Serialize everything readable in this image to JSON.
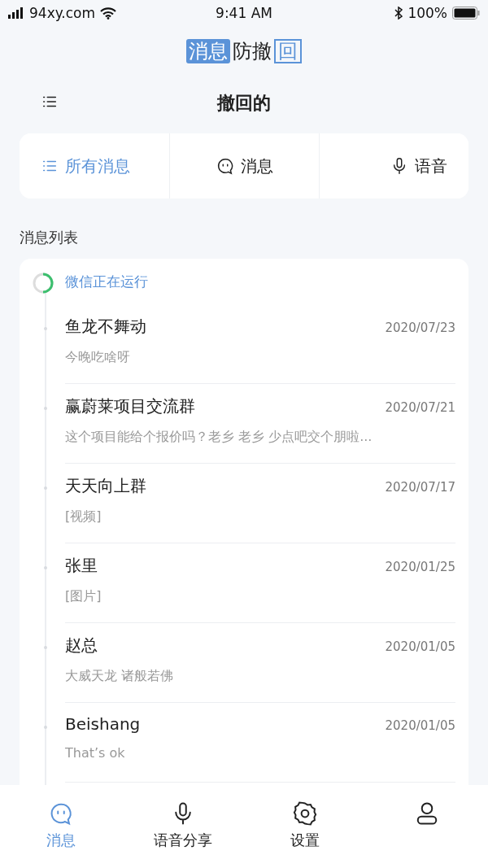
{
  "status_bar": {
    "carrier": "94xy.com",
    "time": "9:41 AM",
    "battery": "100%"
  },
  "logo": [
    {
      "text": "消息",
      "kind": "filled"
    },
    {
      "text": "防撤",
      "kind": "plain"
    },
    {
      "text": "回",
      "kind": "outlined"
    }
  ],
  "header": {
    "title": "撤回的"
  },
  "filters": [
    {
      "label": "所有消息",
      "kind": "list",
      "selected": true
    },
    {
      "label": "消息",
      "kind": "chat",
      "selected": false
    },
    {
      "label": "语音",
      "kind": "mic",
      "selected": false
    }
  ],
  "section_title": "消息列表",
  "app_status": "微信正在运行",
  "messages": [
    {
      "name": "鱼龙不舞动",
      "date": "2020/07/23",
      "preview": "今晚吃啥呀"
    },
    {
      "name": "赢蔚莱项目交流群",
      "date": "2020/07/21",
      "preview": "这个项目能给个报价吗？老乡 老乡  少点吧交个朋啦..."
    },
    {
      "name": "天天向上群",
      "date": "2020/07/17",
      "preview": "[视频]"
    },
    {
      "name": "张里",
      "date": "2020/01/25",
      "preview": "[图片]"
    },
    {
      "name": "赵总",
      "date": "2020/01/05",
      "preview": "大威天龙 诸般若佛"
    },
    {
      "name": "Beishang",
      "date": "2020/01/05",
      "preview": "That’s ok"
    }
  ],
  "tab_bar": [
    {
      "label": "消息",
      "kind": "chat",
      "selected": true
    },
    {
      "label": "语音分享",
      "kind": "mic",
      "selected": false
    },
    {
      "label": "设置",
      "kind": "gear",
      "selected": false
    },
    {
      "kind": "user",
      "selected": false
    }
  ]
}
